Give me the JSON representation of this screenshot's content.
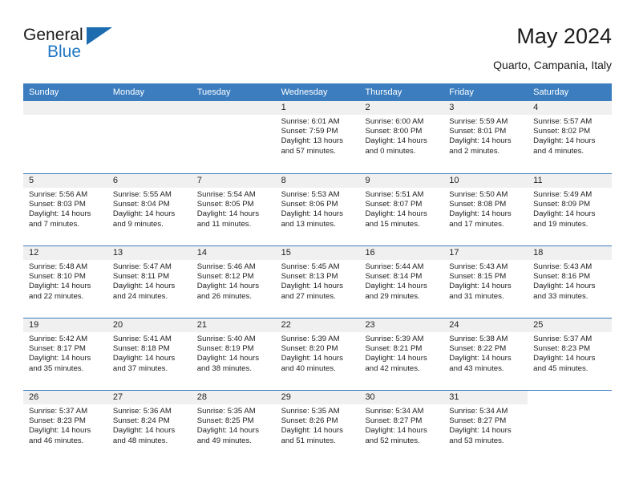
{
  "brand": {
    "line1": "General",
    "line2": "Blue",
    "flag_icon": "blue-flag-icon",
    "accent_color": "#1f77c4"
  },
  "header": {
    "title": "May 2024",
    "location": "Quarto, Campania, Italy"
  },
  "calendar": {
    "header_bg": "#3b7dbf",
    "daynum_bg": "#f0f0f0",
    "weekdays": [
      "Sunday",
      "Monday",
      "Tuesday",
      "Wednesday",
      "Thursday",
      "Friday",
      "Saturday"
    ],
    "weeks": [
      [
        {
          "day": "",
          "lines": []
        },
        {
          "day": "",
          "lines": []
        },
        {
          "day": "",
          "lines": []
        },
        {
          "day": "1",
          "lines": [
            "Sunrise: 6:01 AM",
            "Sunset: 7:59 PM",
            "Daylight: 13 hours and 57 minutes."
          ]
        },
        {
          "day": "2",
          "lines": [
            "Sunrise: 6:00 AM",
            "Sunset: 8:00 PM",
            "Daylight: 14 hours and 0 minutes."
          ]
        },
        {
          "day": "3",
          "lines": [
            "Sunrise: 5:59 AM",
            "Sunset: 8:01 PM",
            "Daylight: 14 hours and 2 minutes."
          ]
        },
        {
          "day": "4",
          "lines": [
            "Sunrise: 5:57 AM",
            "Sunset: 8:02 PM",
            "Daylight: 14 hours and 4 minutes."
          ]
        }
      ],
      [
        {
          "day": "5",
          "lines": [
            "Sunrise: 5:56 AM",
            "Sunset: 8:03 PM",
            "Daylight: 14 hours and 7 minutes."
          ]
        },
        {
          "day": "6",
          "lines": [
            "Sunrise: 5:55 AM",
            "Sunset: 8:04 PM",
            "Daylight: 14 hours and 9 minutes."
          ]
        },
        {
          "day": "7",
          "lines": [
            "Sunrise: 5:54 AM",
            "Sunset: 8:05 PM",
            "Daylight: 14 hours and 11 minutes."
          ]
        },
        {
          "day": "8",
          "lines": [
            "Sunrise: 5:53 AM",
            "Sunset: 8:06 PM",
            "Daylight: 14 hours and 13 minutes."
          ]
        },
        {
          "day": "9",
          "lines": [
            "Sunrise: 5:51 AM",
            "Sunset: 8:07 PM",
            "Daylight: 14 hours and 15 minutes."
          ]
        },
        {
          "day": "10",
          "lines": [
            "Sunrise: 5:50 AM",
            "Sunset: 8:08 PM",
            "Daylight: 14 hours and 17 minutes."
          ]
        },
        {
          "day": "11",
          "lines": [
            "Sunrise: 5:49 AM",
            "Sunset: 8:09 PM",
            "Daylight: 14 hours and 19 minutes."
          ]
        }
      ],
      [
        {
          "day": "12",
          "lines": [
            "Sunrise: 5:48 AM",
            "Sunset: 8:10 PM",
            "Daylight: 14 hours and 22 minutes."
          ]
        },
        {
          "day": "13",
          "lines": [
            "Sunrise: 5:47 AM",
            "Sunset: 8:11 PM",
            "Daylight: 14 hours and 24 minutes."
          ]
        },
        {
          "day": "14",
          "lines": [
            "Sunrise: 5:46 AM",
            "Sunset: 8:12 PM",
            "Daylight: 14 hours and 26 minutes."
          ]
        },
        {
          "day": "15",
          "lines": [
            "Sunrise: 5:45 AM",
            "Sunset: 8:13 PM",
            "Daylight: 14 hours and 27 minutes."
          ]
        },
        {
          "day": "16",
          "lines": [
            "Sunrise: 5:44 AM",
            "Sunset: 8:14 PM",
            "Daylight: 14 hours and 29 minutes."
          ]
        },
        {
          "day": "17",
          "lines": [
            "Sunrise: 5:43 AM",
            "Sunset: 8:15 PM",
            "Daylight: 14 hours and 31 minutes."
          ]
        },
        {
          "day": "18",
          "lines": [
            "Sunrise: 5:43 AM",
            "Sunset: 8:16 PM",
            "Daylight: 14 hours and 33 minutes."
          ]
        }
      ],
      [
        {
          "day": "19",
          "lines": [
            "Sunrise: 5:42 AM",
            "Sunset: 8:17 PM",
            "Daylight: 14 hours and 35 minutes."
          ]
        },
        {
          "day": "20",
          "lines": [
            "Sunrise: 5:41 AM",
            "Sunset: 8:18 PM",
            "Daylight: 14 hours and 37 minutes."
          ]
        },
        {
          "day": "21",
          "lines": [
            "Sunrise: 5:40 AM",
            "Sunset: 8:19 PM",
            "Daylight: 14 hours and 38 minutes."
          ]
        },
        {
          "day": "22",
          "lines": [
            "Sunrise: 5:39 AM",
            "Sunset: 8:20 PM",
            "Daylight: 14 hours and 40 minutes."
          ]
        },
        {
          "day": "23",
          "lines": [
            "Sunrise: 5:39 AM",
            "Sunset: 8:21 PM",
            "Daylight: 14 hours and 42 minutes."
          ]
        },
        {
          "day": "24",
          "lines": [
            "Sunrise: 5:38 AM",
            "Sunset: 8:22 PM",
            "Daylight: 14 hours and 43 minutes."
          ]
        },
        {
          "day": "25",
          "lines": [
            "Sunrise: 5:37 AM",
            "Sunset: 8:23 PM",
            "Daylight: 14 hours and 45 minutes."
          ]
        }
      ],
      [
        {
          "day": "26",
          "lines": [
            "Sunrise: 5:37 AM",
            "Sunset: 8:23 PM",
            "Daylight: 14 hours and 46 minutes."
          ]
        },
        {
          "day": "27",
          "lines": [
            "Sunrise: 5:36 AM",
            "Sunset: 8:24 PM",
            "Daylight: 14 hours and 48 minutes."
          ]
        },
        {
          "day": "28",
          "lines": [
            "Sunrise: 5:35 AM",
            "Sunset: 8:25 PM",
            "Daylight: 14 hours and 49 minutes."
          ]
        },
        {
          "day": "29",
          "lines": [
            "Sunrise: 5:35 AM",
            "Sunset: 8:26 PM",
            "Daylight: 14 hours and 51 minutes."
          ]
        },
        {
          "day": "30",
          "lines": [
            "Sunrise: 5:34 AM",
            "Sunset: 8:27 PM",
            "Daylight: 14 hours and 52 minutes."
          ]
        },
        {
          "day": "31",
          "lines": [
            "Sunrise: 5:34 AM",
            "Sunset: 8:27 PM",
            "Daylight: 14 hours and 53 minutes."
          ]
        },
        {
          "day": "",
          "lines": [],
          "blank": true
        }
      ]
    ]
  }
}
